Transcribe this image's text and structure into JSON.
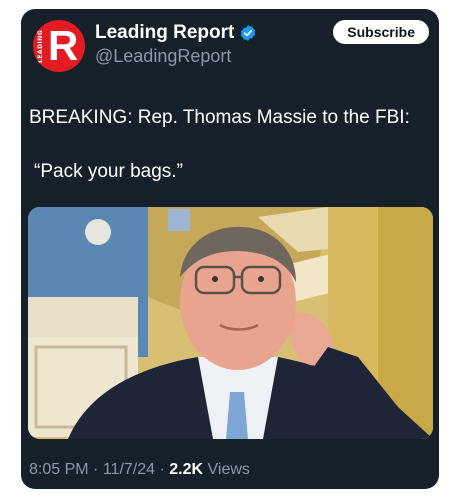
{
  "account": {
    "name": "Leading Report",
    "handle": "@LeadingReport",
    "avatar_letter": "R",
    "avatar_side_text": "LEADING"
  },
  "subscribe_label": "Subscribe",
  "post": {
    "line1": "BREAKING: Rep. Thomas Massie to the FBI:",
    "line2": "“Pack your bags.”"
  },
  "meta": {
    "time": "8:05 PM",
    "sep1": "·",
    "date": "11/7/24",
    "sep2": "·",
    "views_count": "2.2K",
    "views_label": "Views"
  },
  "colors": {
    "card_bg": "#15202b",
    "brand_red": "#e31b23",
    "verified_blue": "#1d9bf0",
    "muted_text": "#8b98a5"
  },
  "icons": [
    "verified-badge-icon"
  ]
}
